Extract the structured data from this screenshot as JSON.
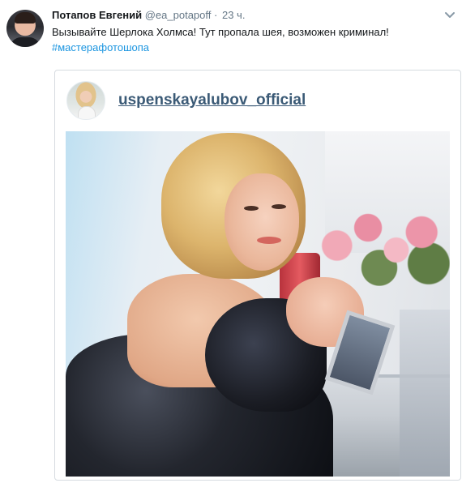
{
  "tweet": {
    "author_name": "Потапов Евгений",
    "author_handle": "@ea_potapoff",
    "separator": "·",
    "time": "23 ч.",
    "text": "Вызывайте Шерлока Холмса! Тут пропала шея, возможен криминал!",
    "hashtag": "#мастерафотошопа",
    "menu_icon": "chevron-down-icon"
  },
  "embed": {
    "username": "uspenskayalubov_official",
    "photo_icon": "photo"
  },
  "colors": {
    "hashtag": "#1b95e0",
    "username_link": "#3b5a76",
    "secondary_text": "#657786"
  }
}
